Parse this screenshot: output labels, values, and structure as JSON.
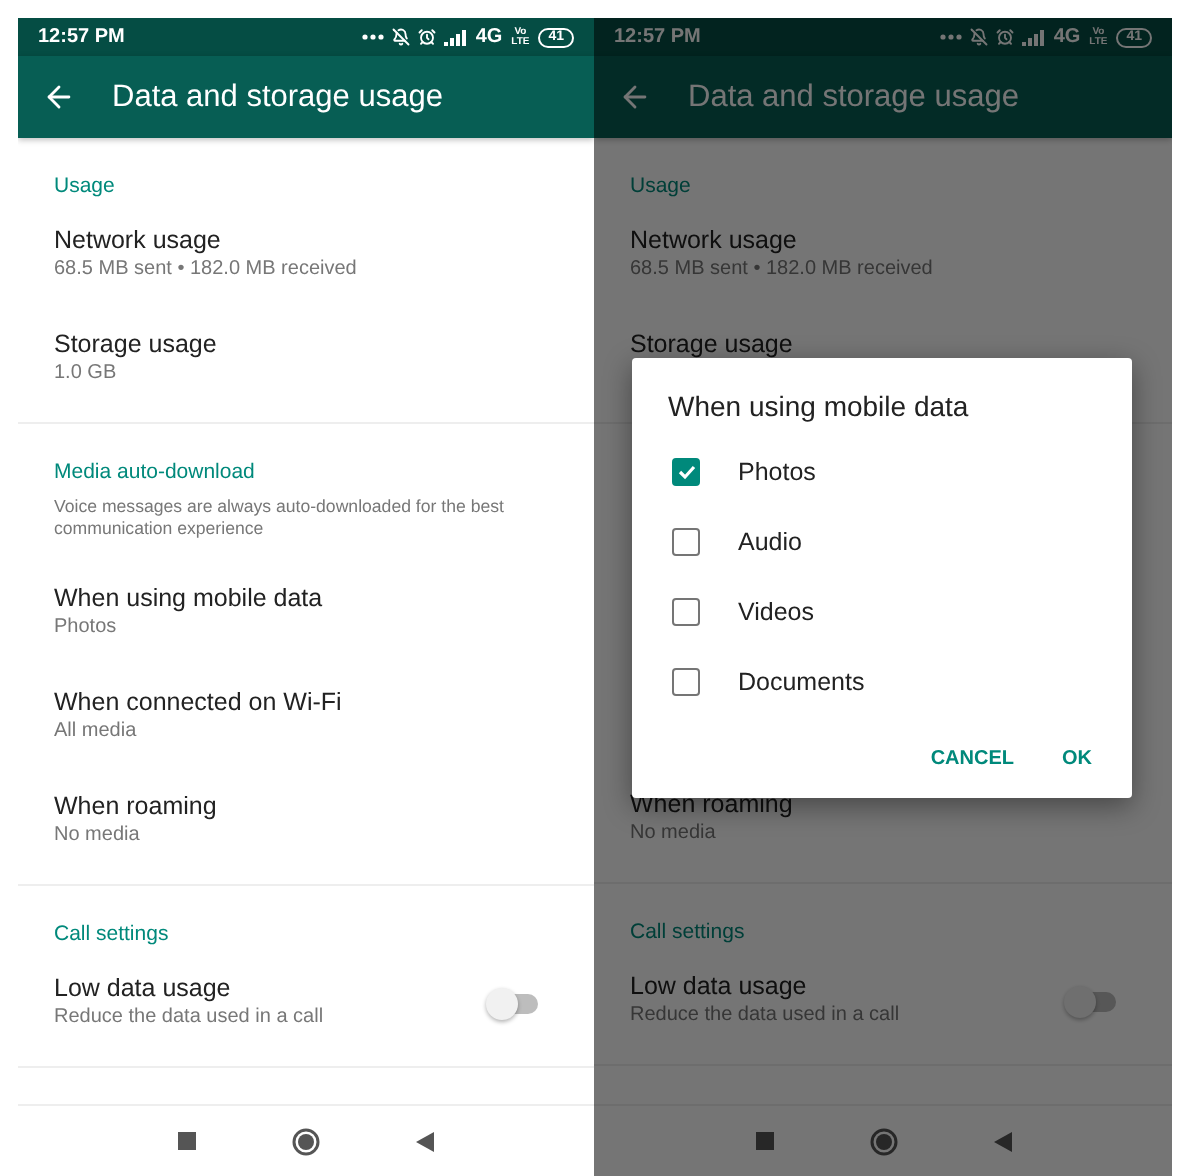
{
  "screens": [
    {
      "status_bar": {
        "time": "12:57 PM",
        "network": "4G",
        "volte": "Vo LTE",
        "battery": "41"
      },
      "app_bar": {
        "title": "Data and storage usage"
      },
      "sections": [
        {
          "kind": "section",
          "header": "Usage",
          "items": [
            {
              "title": "Network usage",
              "subtitle": "68.5 MB sent • 182.0 MB received"
            },
            {
              "title": "Storage usage",
              "subtitle": "1.0 GB"
            }
          ]
        },
        {
          "kind": "section",
          "header": "Media auto-download",
          "note": "Voice messages are always auto-downloaded for the best communication experience",
          "items": [
            {
              "title": "When using mobile data",
              "subtitle": "Photos"
            },
            {
              "title": "When connected on Wi-Fi",
              "subtitle": "All media"
            },
            {
              "title": "When roaming",
              "subtitle": "No media"
            }
          ]
        },
        {
          "kind": "section",
          "header": "Call settings",
          "items": [
            {
              "title": "Low data usage",
              "subtitle": "Reduce the data used in a call",
              "toggle": {
                "on": false
              }
            }
          ]
        }
      ]
    },
    {
      "status_bar": {
        "time": "12:57 PM",
        "network": "4G",
        "volte": "Vo LTE",
        "battery": "41"
      },
      "app_bar": {
        "title": "Data and storage usage"
      },
      "sections": [
        {
          "kind": "section",
          "header": "Usage",
          "items": [
            {
              "title": "Network usage",
              "subtitle": "68.5 MB sent • 182.0 MB received"
            },
            {
              "title": "Storage usage"
            }
          ]
        },
        {
          "kind": "obscured"
        },
        {
          "kind": "tail",
          "items": [
            {
              "title": "When roaming",
              "subtitle": "No media"
            }
          ]
        },
        {
          "kind": "section",
          "header": "Call settings",
          "items": [
            {
              "title": "Low data usage",
              "subtitle": "Reduce the data used in a call",
              "toggle": {
                "on": false
              }
            }
          ]
        }
      ],
      "dialog": {
        "title": "When using mobile data",
        "options": [
          {
            "label": "Photos",
            "checked": true
          },
          {
            "label": "Audio",
            "checked": false
          },
          {
            "label": "Videos",
            "checked": false
          },
          {
            "label": "Documents",
            "checked": false
          }
        ],
        "buttons": [
          "CANCEL",
          "OK"
        ]
      }
    }
  ]
}
